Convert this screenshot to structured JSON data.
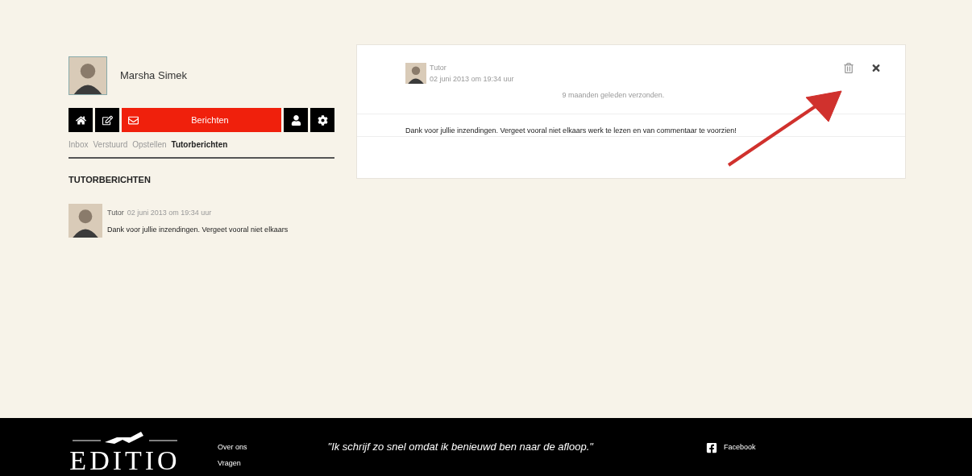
{
  "profile": {
    "name": "Marsha Simek"
  },
  "nav": {
    "buttons": [
      {
        "kind": "home",
        "selected": false
      },
      {
        "kind": "edit",
        "selected": false
      },
      {
        "kind": "mail",
        "label": "Berichten",
        "selected": true
      },
      {
        "kind": "user",
        "selected": false
      },
      {
        "kind": "settings",
        "selected": false
      }
    ]
  },
  "subnav": [
    {
      "label": "Inbox",
      "selected": false
    },
    {
      "label": "Verstuurd",
      "selected": false
    },
    {
      "label": "Opstellen",
      "selected": false
    },
    {
      "label": "Tutorberichten",
      "selected": true
    }
  ],
  "section_title": "TUTORBERICHTEN",
  "messages": [
    {
      "sender": "Tutor",
      "date": "02 juni 2013 om 19:34 uur",
      "preview": "Dank voor jullie inzendingen. Vergeet vooral niet elkaars"
    }
  ],
  "detail": {
    "sender": "Tutor",
    "date": "02 juni 2013 om 19:34 uur",
    "sent_ago": "9 maanden geleden verzonden.",
    "body": "Dank voor jullie inzendingen. Vergeet vooral niet elkaars werk te lezen en van commentaar te voorzien!"
  },
  "footer": {
    "logo": "EDITIO",
    "links": [
      "Over ons",
      "Vragen"
    ],
    "quote": "\"Ik schrijf zo snel omdat ik benieuwd ben naar de afloop.\"",
    "social": [
      "Facebook"
    ]
  }
}
